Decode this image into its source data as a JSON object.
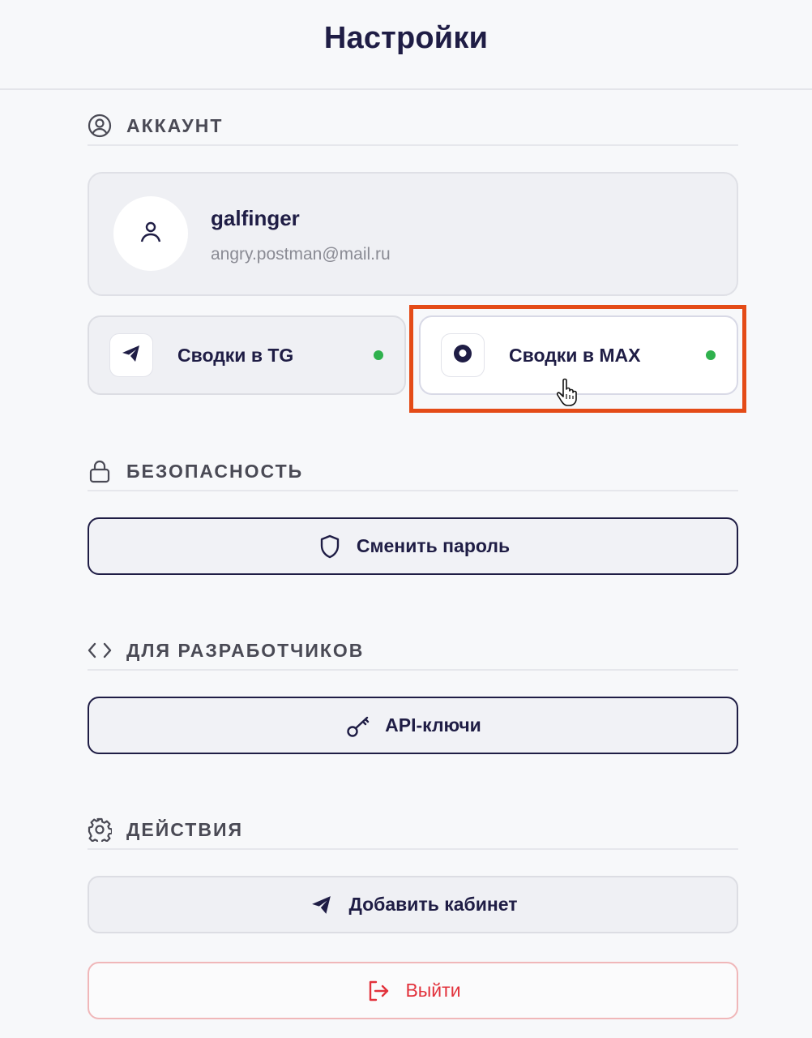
{
  "header": {
    "title": "Настройки"
  },
  "sections": {
    "account": {
      "title": "АККАУНТ",
      "icon": "user-circle-icon"
    },
    "security": {
      "title": "БЕЗОПАСНОСТЬ",
      "icon": "lock-icon"
    },
    "developers": {
      "title": "ДЛЯ РАЗРАБОТЧИКОВ",
      "icon": "code-icon"
    },
    "actions": {
      "title": "ДЕЙСТВИЯ",
      "icon": "gear-icon"
    }
  },
  "profile": {
    "username": "galfinger",
    "email": "angry.postman@mail.ru",
    "icon": "user-icon"
  },
  "digests": [
    {
      "label": "Сводки в TG",
      "icon": "telegram-icon",
      "status": "active",
      "status_color": "#2fb14d"
    },
    {
      "label": "Сводки в MAX",
      "icon": "max-icon",
      "status": "active",
      "status_color": "#2fb14d"
    }
  ],
  "buttons": {
    "change_password": {
      "label": "Сменить пароль",
      "icon": "shield-icon"
    },
    "api_keys": {
      "label": "API-ключи",
      "icon": "key-icon"
    },
    "add_cabinet": {
      "label": "Добавить кабинет",
      "icon": "telegram-icon"
    },
    "logout": {
      "label": "Выйти",
      "icon": "logout-icon",
      "color": "#e2323c"
    }
  },
  "colors": {
    "accent": "#1f1d45",
    "highlight": "#e44b17",
    "danger": "#e2323c",
    "status": "#2fb14d"
  }
}
